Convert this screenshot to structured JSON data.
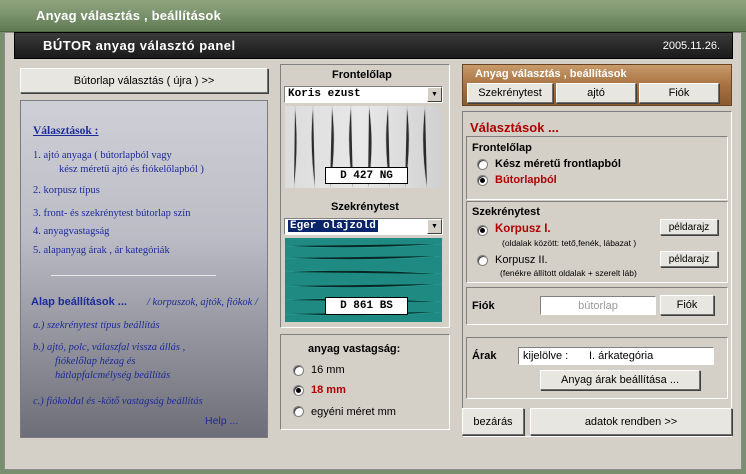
{
  "window": {
    "title": "Anyag választás ,  beállítások"
  },
  "header": {
    "title": "BÚTOR  anyag  választó  panel",
    "date": "2005.11.26."
  },
  "left": {
    "reselect_button": "Bútorlap  választás  ( újra )  >>",
    "choices_title": "Választások :",
    "choices": [
      "1.  ajtó anyaga    ( bútorlapból  vagy",
      "kész  méretű  ajtó  és  fiókelőlapból )",
      "2.  korpusz típus",
      "3.  front- és  szekrénytest bútorlap szín",
      "4.  anyagvastagság",
      "5.  alapanyag árak , ár kategóriák"
    ],
    "basic_title": "Alap beállítások ...",
    "basic_subtitle": "/ korpuszok, ajtók, fiókok /",
    "basic_items": [
      "a.)  szekrénytest típus beállítás",
      "b.)  ajtó, polc, válaszfal vissza állás ,",
      "fiókelőlap  hézag  és",
      "hátlapfalcmélység beállítás",
      "c.)  fiókoldal és -kötő vastagság beállítás"
    ],
    "help_link": "Help ..."
  },
  "middle": {
    "front_label": "Frontelőlap",
    "front_select": "Koris   ezust",
    "front_code": "D  427 NG",
    "body_label": "Szekrénytest",
    "body_select": "Eger  olajzold",
    "body_code": "D  861 BS",
    "thickness_label": "anyag vastagság:",
    "thickness_options": [
      "16 mm",
      "18 mm",
      "egyéni méret mm"
    ],
    "thickness_selected": "18 mm"
  },
  "right": {
    "bar_title": "Anyag választás ,  beállítások",
    "tabs": [
      "Szekrénytest",
      "ajtó",
      "Fiók"
    ],
    "choices_title": "Választások ...",
    "front_section_label": "Frontelőlap",
    "front_options": [
      "Kész méretű frontlapból",
      "Bútorlapból"
    ],
    "front_selected": "Bútorlapból",
    "body_section_label": "Szekrénytest",
    "korpusz1_label": "Korpusz  I.",
    "korpusz1_note": "(oldalak között: tető,fenék, lábazat )",
    "korpusz2_label": "Korpusz  II.",
    "korpusz2_note": "(fenékre állított oldalak + szerelt láb)",
    "example_button": "példarajz",
    "drawer_label": "Fiók",
    "drawer_value": "bútorlap",
    "drawer_button": "Fiók",
    "prices_label": "Árak",
    "prices_prefix": "kijelölve :",
    "prices_value": "I.   árkategória",
    "prices_button": "Anyag  árak  beállítása ...",
    "close_button": "bezárás",
    "ok_button": "adatok rendben  >>"
  },
  "colors": {
    "accent_red": "#b00000",
    "link_blue": "#1c2a9a",
    "teal": "#1e8a82"
  }
}
